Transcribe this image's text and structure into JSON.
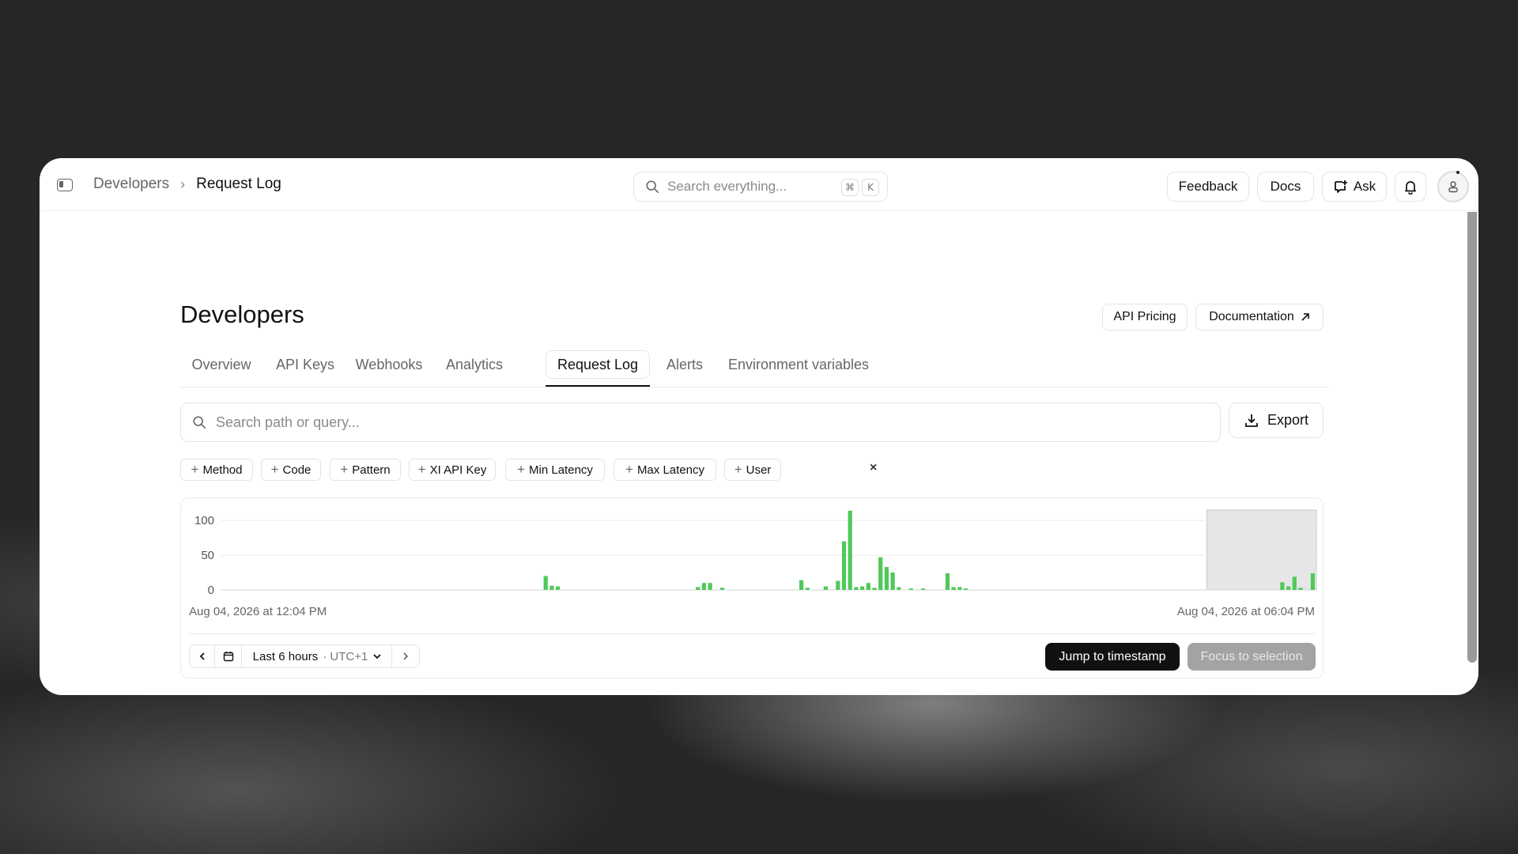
{
  "breadcrumb": {
    "parent": "Developers",
    "separator": "›",
    "current": "Request Log"
  },
  "global_search": {
    "placeholder": "Search everything...",
    "shortcut_keys": [
      "⌘",
      "K"
    ]
  },
  "topbar_buttons": {
    "feedback": "Feedback",
    "docs": "Docs",
    "ask": "Ask"
  },
  "page": {
    "title": "Developers",
    "header_buttons": {
      "api_pricing": "API Pricing",
      "documentation": "Documentation"
    }
  },
  "tabs": [
    {
      "label": "Overview",
      "active": false
    },
    {
      "label": "API Keys",
      "active": false
    },
    {
      "label": "Webhooks",
      "active": false
    },
    {
      "label": "Analytics",
      "active": false
    },
    {
      "label": "Request Log",
      "active": true
    },
    {
      "label": "Alerts",
      "active": false
    },
    {
      "label": "Environment variables",
      "active": false
    }
  ],
  "path_search": {
    "placeholder": "Search path or query..."
  },
  "export_label": "Export",
  "filters": [
    "Method",
    "Code",
    "Pattern",
    "XI API Key",
    "Min Latency",
    "Max Latency",
    "User"
  ],
  "clear_filters": "×",
  "chart_data": {
    "type": "bar",
    "title": "",
    "xlabel": "",
    "ylabel": "",
    "ylim": [
      0,
      115
    ],
    "y_ticks": [
      0,
      50,
      100
    ],
    "bar_color": "#4fc95a",
    "x_start_label": "Aug 04, 2026 at 12:04 PM",
    "x_end_label": "Aug 04, 2026 at 06:04 PM",
    "bucket_count": 180,
    "bars": [
      {
        "bucket": 53,
        "value": 20
      },
      {
        "bucket": 54,
        "value": 6
      },
      {
        "bucket": 55,
        "value": 5
      },
      {
        "bucket": 78,
        "value": 4
      },
      {
        "bucket": 79,
        "value": 10
      },
      {
        "bucket": 80,
        "value": 10
      },
      {
        "bucket": 82,
        "value": 3
      },
      {
        "bucket": 95,
        "value": 14
      },
      {
        "bucket": 96,
        "value": 3
      },
      {
        "bucket": 99,
        "value": 5
      },
      {
        "bucket": 101,
        "value": 13
      },
      {
        "bucket": 102,
        "value": 70
      },
      {
        "bucket": 103,
        "value": 114
      },
      {
        "bucket": 104,
        "value": 4
      },
      {
        "bucket": 105,
        "value": 5
      },
      {
        "bucket": 106,
        "value": 10
      },
      {
        "bucket": 107,
        "value": 3
      },
      {
        "bucket": 108,
        "value": 47
      },
      {
        "bucket": 109,
        "value": 33
      },
      {
        "bucket": 110,
        "value": 25
      },
      {
        "bucket": 111,
        "value": 4
      },
      {
        "bucket": 113,
        "value": 2
      },
      {
        "bucket": 115,
        "value": 2
      },
      {
        "bucket": 119,
        "value": 24
      },
      {
        "bucket": 120,
        "value": 4
      },
      {
        "bucket": 121,
        "value": 4
      },
      {
        "bucket": 122,
        "value": 2
      },
      {
        "bucket": 174,
        "value": 11
      },
      {
        "bucket": 175,
        "value": 5
      },
      {
        "bucket": 176,
        "value": 19
      },
      {
        "bucket": 177,
        "value": 3
      },
      {
        "bucket": 179,
        "value": 24
      }
    ],
    "selection": {
      "start_bucket": 162,
      "end_bucket": 180
    }
  },
  "range_control": {
    "label": "Last 6 hours",
    "timezone": "· UTC+1"
  },
  "actions": {
    "jump": "Jump to timestamp",
    "focus": "Focus to selection"
  }
}
